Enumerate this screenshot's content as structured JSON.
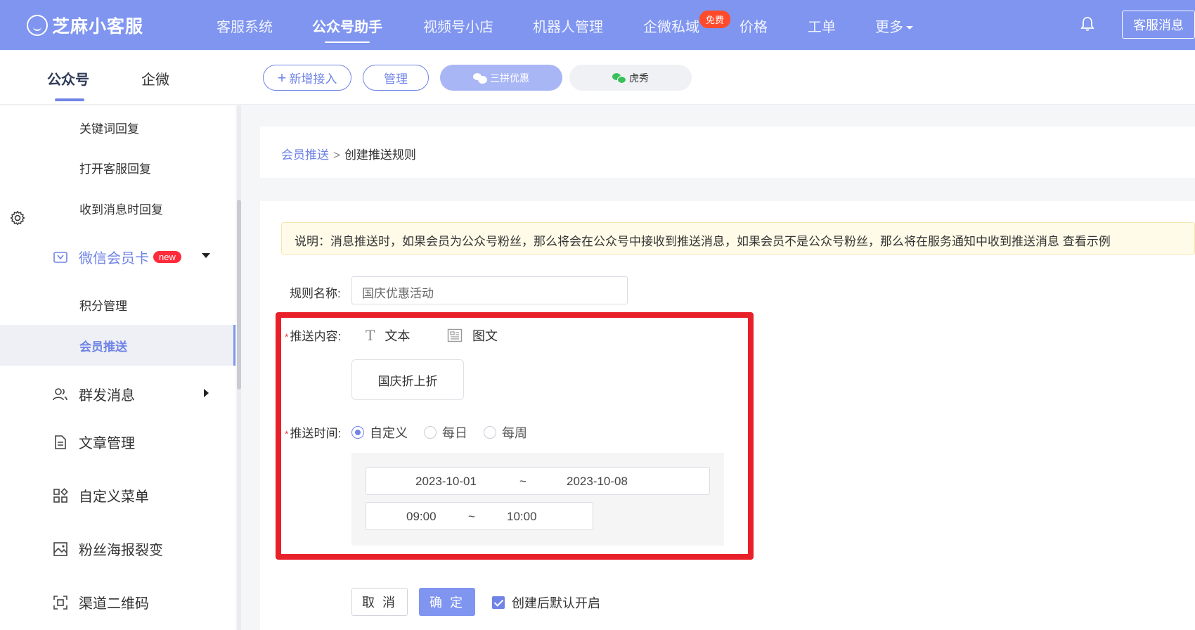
{
  "app": {
    "logo_text": "芝麻小客服"
  },
  "topnav": {
    "items": [
      "客服系统",
      "公众号助手",
      "视频号小店",
      "机器人管理",
      "企微私域",
      "价格",
      "工单",
      "更多"
    ],
    "active": "公众号助手",
    "free_badge": "免费",
    "message_button": "客服消息"
  },
  "subbar": {
    "account_tabs": [
      "公众号",
      "企微"
    ],
    "add_button": "新增接入",
    "manage_button": "管理",
    "accounts": [
      "三拼优惠",
      "虎秀"
    ]
  },
  "sidebar": {
    "sub_items_top": [
      "关键词回复",
      "打开客服回复",
      "收到消息时回复"
    ],
    "member_card": {
      "label": "微信会员卡",
      "badge": "new"
    },
    "member_sub": [
      "积分管理",
      "会员推送"
    ],
    "main_items": [
      "群发消息",
      "文章管理",
      "自定义菜单",
      "粉丝海报裂变",
      "渠道二维码"
    ]
  },
  "breadcrumb": {
    "parent": "会员推送",
    "separator": ">",
    "current": "创建推送规则"
  },
  "form": {
    "notice": "说明：消息推送时，如果会员为公众号粉丝，那么将会在公众号中接收到推送消息，如果会员不是公众号粉丝，那么将在服务通知中收到推送消息 查看示例",
    "name_label": "规则名称:",
    "name_value": "国庆优惠活动",
    "content_label": "推送内容:",
    "content_types": [
      "文本",
      "图文"
    ],
    "content_card": "国庆折上折",
    "time_label": "推送时间:",
    "time_options": [
      "自定义",
      "每日",
      "每周"
    ],
    "time_selected": "自定义",
    "date_start": "2023-10-01",
    "date_end": "2023-10-08",
    "time_start": "09:00",
    "time_end": "10:00",
    "range_sep": "~",
    "cancel": "取 消",
    "confirm": "确 定",
    "enable_checkbox": "创建后默认开启",
    "enable_checked": true
  },
  "colors": {
    "brand": "#7f95ef",
    "highlight": "#e8202a",
    "badge_red": "#ff2b3a"
  }
}
